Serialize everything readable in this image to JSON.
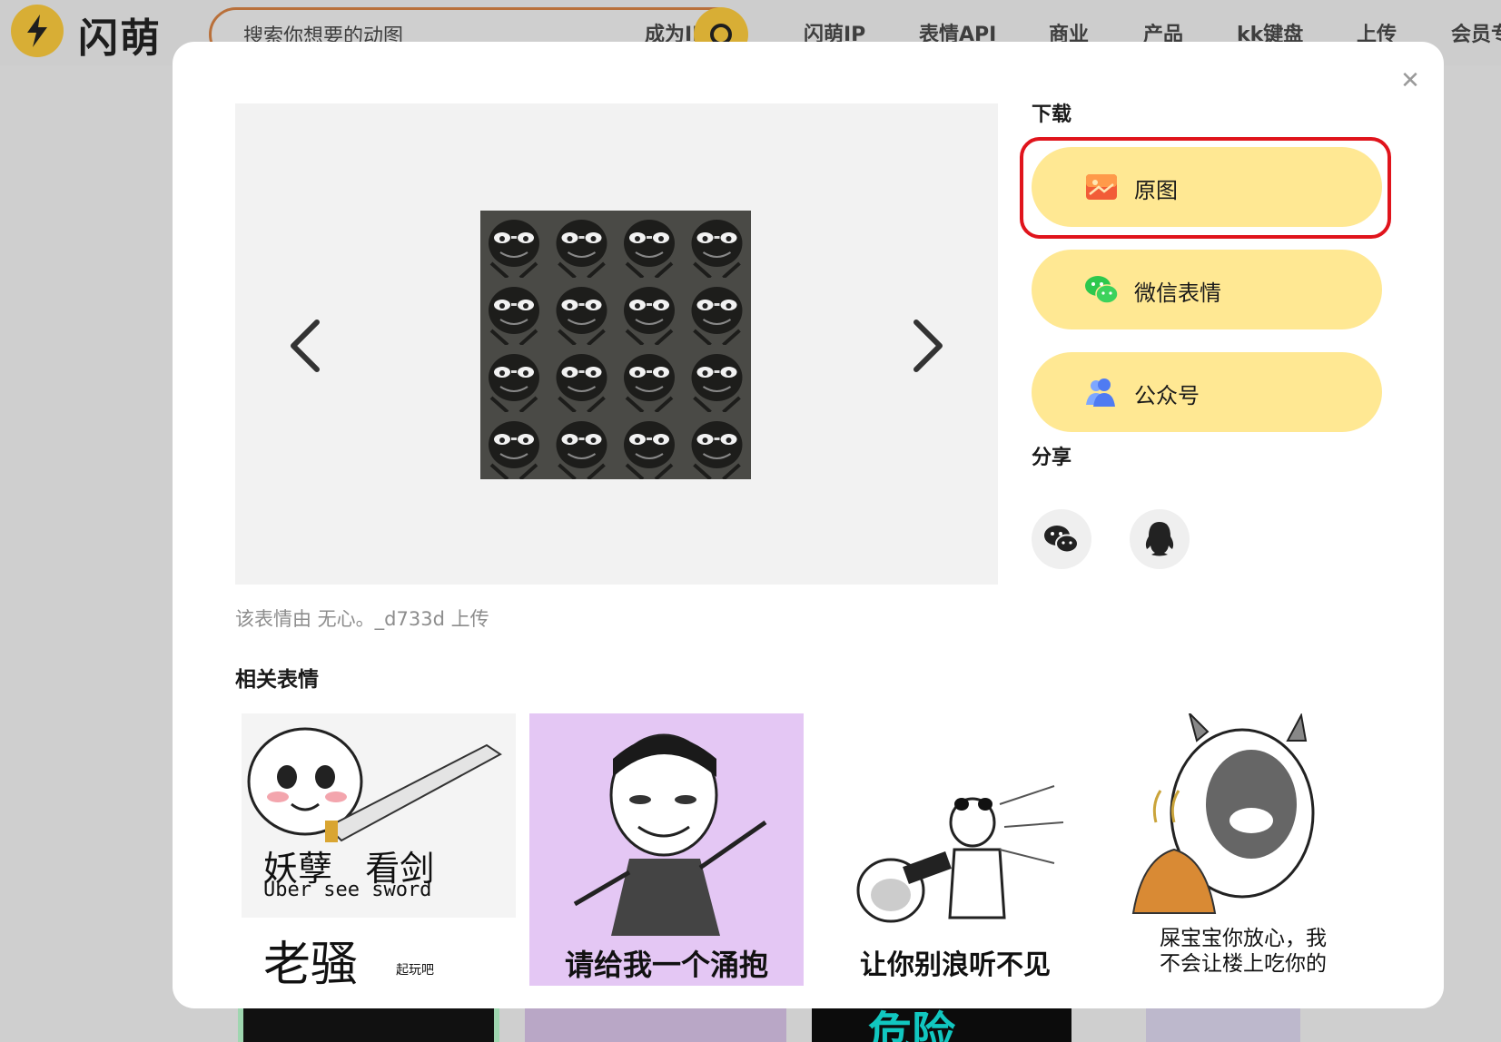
{
  "header": {
    "logo_text": "闪萌",
    "search_placeholder": "搜索你想要的动图",
    "nav": [
      "成为IP",
      "闪萌IP",
      "表情API",
      "商业",
      "产品",
      "kk键盘",
      "上传",
      "会员专"
    ]
  },
  "modal": {
    "download_title": "下载",
    "download_buttons": [
      {
        "label": "原图",
        "icon": "image-icon"
      },
      {
        "label": "微信表情",
        "icon": "wechat-icon"
      },
      {
        "label": "公众号",
        "icon": "users-icon"
      }
    ],
    "share_title": "分享",
    "share_buttons": [
      {
        "icon": "wechat-icon"
      },
      {
        "icon": "qq-icon"
      }
    ],
    "uploader_text": "该表情由 无心。_d733d 上传",
    "related_title": "相关表情",
    "related": [
      {
        "top_text": "妖孽   看剑",
        "sub_text": "Uber see sword",
        "bottom_text": "老骚",
        "tiny_text": "起玩吧"
      },
      {
        "caption": "请给我一个涌抱"
      },
      {
        "caption": "让你别浪听不见"
      },
      {
        "caption_line1": "屎宝宝你放心，我",
        "caption_line2": "不会让楼上吃你的"
      }
    ],
    "peek_text": "危险",
    "colors": {
      "accent": "#ffe893",
      "highlight": "#e0141c",
      "brand": "#d8ae35"
    }
  }
}
